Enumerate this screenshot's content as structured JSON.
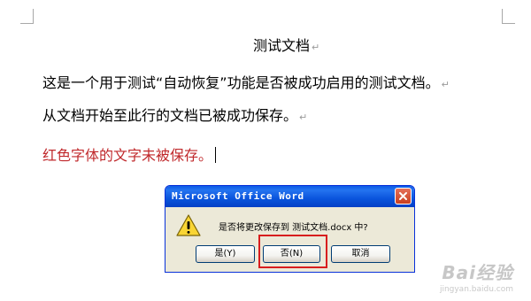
{
  "document": {
    "title": "测试文档",
    "lines": [
      "这是一个用于测试“自动恢复”功能是否被成功启用的测试文档。",
      "从文档开始至此行的文档已被成功保存。",
      "红色字体的文字未被保存。"
    ],
    "paragraph_mark": "↵",
    "unsaved_text_color": "#c0282b"
  },
  "dialog": {
    "title": "Microsoft Office Word",
    "message": "是否将更改保存到 测试文档.docx 中?",
    "icon": "warning-icon",
    "buttons": {
      "yes": "是(Y)",
      "no": "否(N)",
      "cancel": "取消"
    },
    "highlighted_button": "no",
    "highlight_color": "#d81e1e"
  },
  "watermark": {
    "brand": "Bai经验",
    "url": "jingyan.baidu.com"
  }
}
